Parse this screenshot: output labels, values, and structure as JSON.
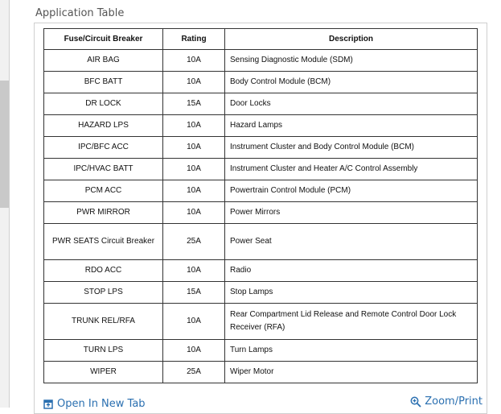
{
  "section_title": "Application Table",
  "table": {
    "headers": [
      "Fuse/Circuit Breaker",
      "Rating",
      "Description"
    ],
    "rows": [
      {
        "fuse": "AIR BAG",
        "rating": "10A",
        "description": "Sensing Diagnostic Module (SDM)"
      },
      {
        "fuse": "BFC BATT",
        "rating": "10A",
        "description": "Body Control Module (BCM)"
      },
      {
        "fuse": "DR LOCK",
        "rating": "15A",
        "description": "Door Locks"
      },
      {
        "fuse": "HAZARD LPS",
        "rating": "10A",
        "description": "Hazard Lamps"
      },
      {
        "fuse": "IPC/BFC ACC",
        "rating": "10A",
        "description": "Instrument Cluster and Body Control Module (BCM)"
      },
      {
        "fuse": "IPC/HVAC BATT",
        "rating": "10A",
        "description": "Instrument Cluster and Heater A/C Control Assembly"
      },
      {
        "fuse": "PCM ACC",
        "rating": "10A",
        "description": "Powertrain Control Module (PCM)"
      },
      {
        "fuse": "PWR MIRROR",
        "rating": "10A",
        "description": "Power Mirrors"
      },
      {
        "fuse": "PWR SEATS Circuit Breaker",
        "rating": "25A",
        "description": "Power Seat"
      },
      {
        "fuse": "RDO ACC",
        "rating": "10A",
        "description": "Radio"
      },
      {
        "fuse": "STOP LPS",
        "rating": "15A",
        "description": "Stop Lamps"
      },
      {
        "fuse": "TRUNK REL/RFA",
        "rating": "10A",
        "description": "Rear Compartment Lid Release and Remote Control Door Lock Receiver (RFA)"
      },
      {
        "fuse": "TURN LPS",
        "rating": "10A",
        "description": "Turn Lamps"
      },
      {
        "fuse": "WIPER",
        "rating": "25A",
        "description": "Wiper Motor"
      }
    ]
  },
  "footer": {
    "open_label": "Open In New Tab",
    "zoom_label": "Zoom/Print",
    "open_icon": "open-new-tab-icon",
    "zoom_icon": "zoom-icon",
    "link_color": "#2a6fb0"
  }
}
